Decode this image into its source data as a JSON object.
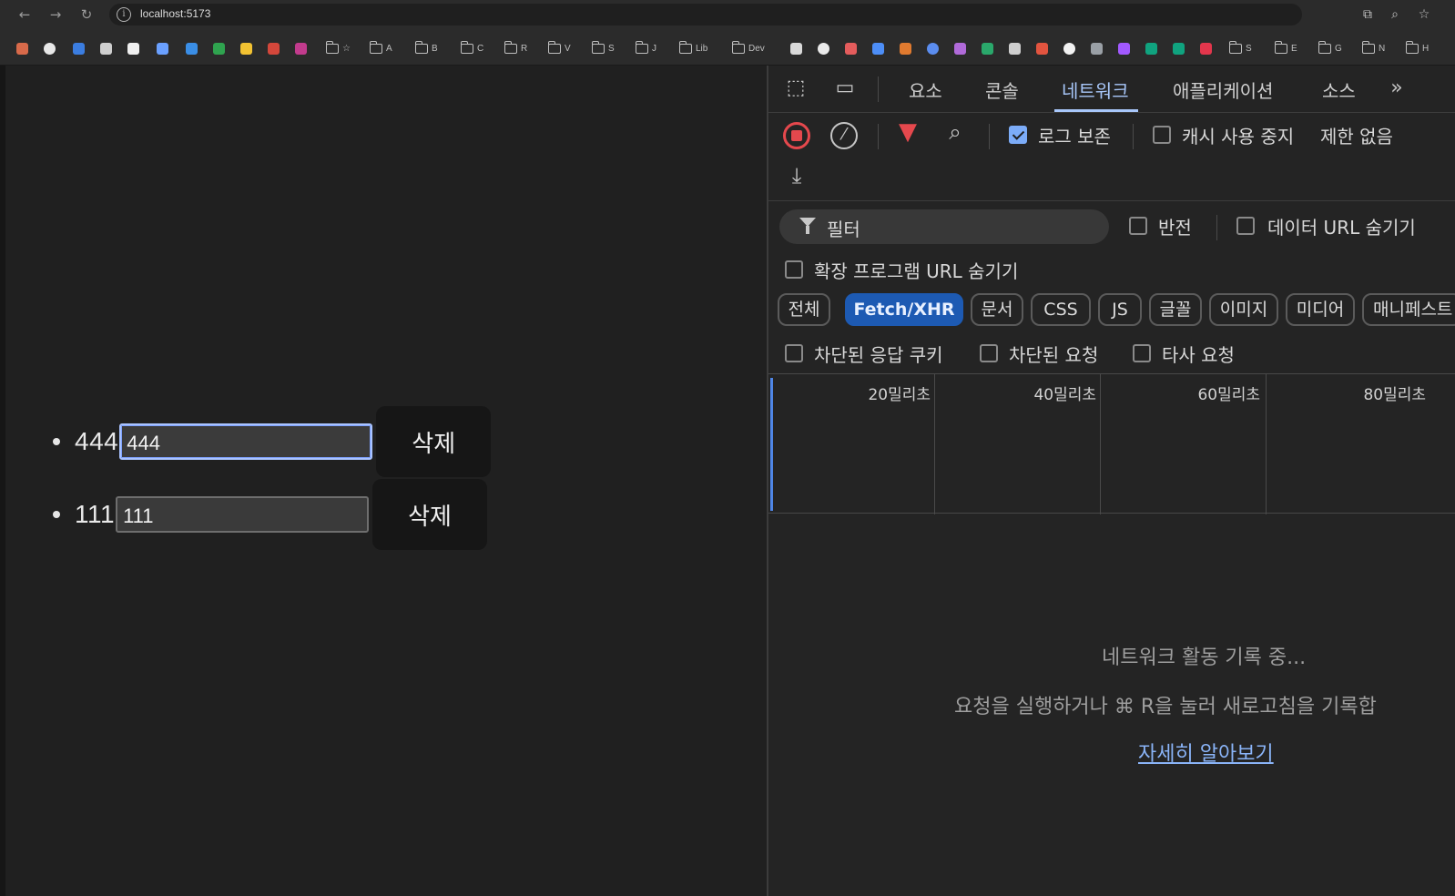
{
  "browser": {
    "url": "localhost:5173",
    "bookmarks": [
      "☆",
      "A",
      "B",
      "C",
      "R",
      "V",
      "S",
      "J",
      "Lib",
      "Dev",
      "S",
      "E",
      "G",
      "N",
      "H"
    ]
  },
  "todos": [
    {
      "text": "444",
      "input_value": "444",
      "delete_label": "삭제",
      "focused": true
    },
    {
      "text": "111",
      "input_value": "111",
      "delete_label": "삭제",
      "focused": false
    }
  ],
  "devtools": {
    "tabs": [
      "요소",
      "콘솔",
      "네트워크",
      "애플리케이션",
      "소스"
    ],
    "active_tab": "네트워크",
    "toolbar": {
      "preserve_log_label": "로그 보존",
      "preserve_log_checked": true,
      "disable_cache_label": "캐시 사용 중지",
      "disable_cache_checked": false,
      "throttling_label": "제한 없음"
    },
    "filter": {
      "placeholder": "필터",
      "invert_label": "반전",
      "hide_data_urls_label": "데이터 URL 숨기기",
      "hide_extension_urls_label": "확장 프로그램 URL 숨기기"
    },
    "type_filters": [
      "전체",
      "Fetch/XHR",
      "문서",
      "CSS",
      "JS",
      "글꼴",
      "이미지",
      "미디어",
      "매니페스트"
    ],
    "active_type_filter": "Fetch/XHR",
    "extra_filters": [
      "차단된 응답 쿠키",
      "차단된 요청",
      "타사 요청"
    ],
    "timeline_labels": [
      "20밀리초",
      "40밀리초",
      "60밀리초",
      "80밀리초"
    ],
    "empty_state": {
      "title": "네트워크 활동 기록 중...",
      "hint": "요청을 실행하거나 ⌘ R을 눌러 새로고침을 기록합",
      "learn_more": "자세히 알아보기"
    },
    "colors": {
      "accent": "#a8c7fa",
      "record": "#e5484d",
      "filter_active": "#e5484d",
      "chip_active": "#1d5ab3"
    }
  }
}
